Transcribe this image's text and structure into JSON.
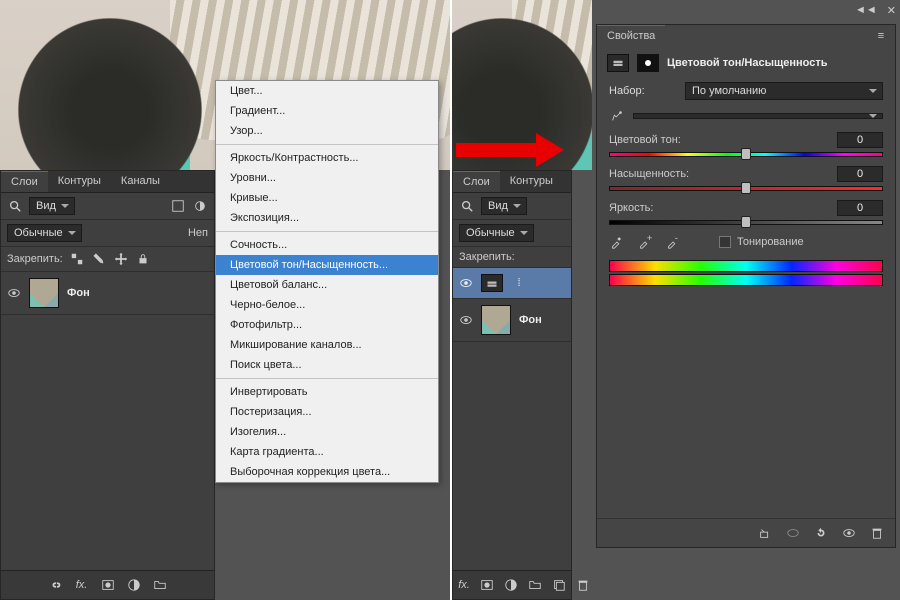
{
  "panels": {
    "layers_tabs": [
      "Слои",
      "Контуры",
      "Каналы"
    ],
    "view_label": "Вид",
    "blend_mode": "Обычные",
    "opacity_label": "Неп",
    "lock_label": "Закрепить:",
    "bg_layer_name": "Фон"
  },
  "menu": {
    "groups": [
      [
        "Цвет...",
        "Градиент...",
        "Узор..."
      ],
      [
        "Яркость/Контрастность...",
        "Уровни...",
        "Кривые...",
        "Экспозиция..."
      ],
      [
        "Сочность...",
        "Цветовой тон/Насыщенность...",
        "Цветовой баланс...",
        "Черно-белое...",
        "Фотофильтр...",
        "Микширование каналов...",
        "Поиск цвета..."
      ],
      [
        "Инвертировать",
        "Постеризация...",
        "Изогелия...",
        "Карта градиента...",
        "Выборочная коррекция цвета..."
      ]
    ],
    "highlighted": "Цветовой тон/Насыщенность..."
  },
  "properties": {
    "tab": "Свойства",
    "title": "Цветовой тон/Насыщенность",
    "preset_label": "Набор:",
    "preset_value": "По умолчанию",
    "range_value": "",
    "hue_label": "Цветовой тон:",
    "hue_value": "0",
    "sat_label": "Насыщенность:",
    "sat_value": "0",
    "lig_label": "Яркость:",
    "lig_value": "0",
    "colorize_label": "Тонирование"
  },
  "right_tabs": [
    "Слои",
    "Контуры"
  ],
  "adjustment_layer_short": "Фон"
}
